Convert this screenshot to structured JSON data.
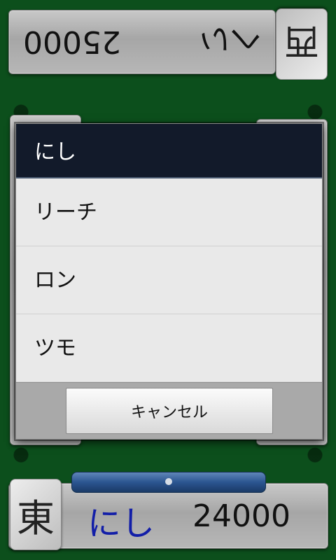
{
  "opponent": {
    "name": "へい",
    "score": "25000",
    "wind_tile": "西"
  },
  "player": {
    "name": "にし",
    "score": "24000",
    "wind_tile": "東"
  },
  "dialog": {
    "title": "にし",
    "options": [
      {
        "label": "リーチ"
      },
      {
        "label": "ロン"
      },
      {
        "label": "ツモ"
      }
    ],
    "cancel_label": "キャンセル"
  }
}
